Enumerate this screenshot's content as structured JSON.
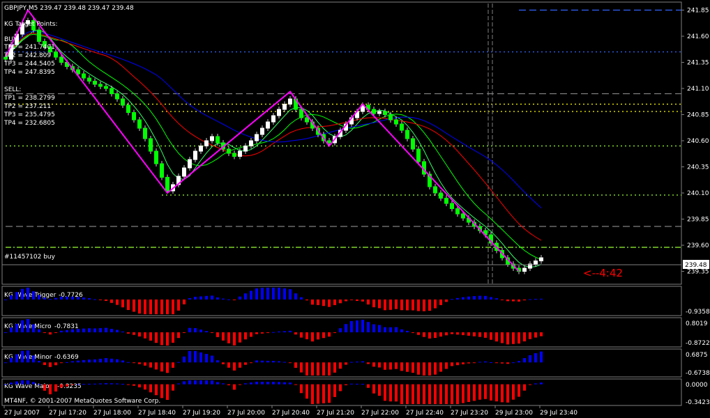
{
  "header": {
    "symbol_line": "GBPJPY,M5  239.47 239.48 239.47 239.48"
  },
  "target_points": {
    "title": "KG Target Points:",
    "buy_label": "BUY:",
    "buy": [
      "TP1 = 241.7401",
      "TP2 = 242.809",
      "TP3 = 244.5405",
      "TP4 = 247.8395"
    ],
    "sell_label": "SELL:",
    "sell": [
      "TP1 = 238.2799",
      "TP2 = 237.211",
      "TP3 = 235.4795",
      "TP4 = 232.6805"
    ]
  },
  "order_label": "#11457102 buy",
  "countdown": "<--4:42",
  "copyright": "MT4NF, © 2001-2007 MetaQuotes Software Corp.",
  "colors": {
    "bull": "#ffffff",
    "bear": "#00ff00",
    "zigzag": "#ff00ff",
    "ma_blue": "#0000ff",
    "ma_red": "#ff0000",
    "ma_green": "#00ff00",
    "ma_lime": "#33ff66",
    "hist_red": "#ff0000",
    "hist_blue": "#0000ff",
    "grid": "#808080",
    "level_yellow": "#ffff00",
    "level_blue": "#3366ff",
    "level_green": "#99ff33"
  },
  "chart_data": {
    "type": "candlestick",
    "y_ticks": [
      "241.85",
      "241.60",
      "241.35",
      "241.10",
      "240.85",
      "240.60",
      "240.35",
      "240.10",
      "239.85",
      "239.60",
      "239.35"
    ],
    "ylim": [
      239.28,
      241.88
    ],
    "current_price": "239.48",
    "x_ticks": [
      "27 Jul 2007",
      "27 Jul 17:20",
      "27 Jul 18:00",
      "27 Jul 18:40",
      "27 Jul 19:20",
      "27 Jul 20:00",
      "27 Jul 20:40",
      "27 Jul 21:20",
      "27 Jul 22:00",
      "27 Jul 22:40",
      "27 Jul 23:20",
      "29 Jul 23:00",
      "29 Jul 23:40"
    ],
    "close": [
      241.38,
      241.52,
      241.62,
      241.72,
      241.75,
      241.66,
      241.55,
      241.5,
      241.45,
      241.4,
      241.35,
      241.31,
      241.28,
      241.24,
      241.2,
      241.17,
      241.14,
      241.12,
      241.1,
      241.05,
      241.0,
      240.94,
      240.87,
      240.8,
      240.72,
      240.62,
      240.5,
      240.38,
      240.25,
      240.12,
      240.18,
      240.26,
      240.34,
      240.42,
      240.5,
      240.55,
      240.6,
      240.64,
      240.58,
      240.52,
      240.48,
      240.45,
      240.5,
      240.55,
      240.6,
      240.66,
      240.72,
      240.78,
      240.84,
      240.9,
      240.95,
      241.0,
      240.9,
      240.82,
      240.78,
      240.72,
      240.66,
      240.6,
      240.58,
      240.64,
      240.7,
      240.76,
      240.82,
      240.88,
      240.94,
      240.9,
      240.86,
      240.88,
      240.85,
      240.8,
      240.76,
      240.7,
      240.62,
      240.52,
      240.4,
      240.28,
      240.16,
      240.1,
      240.05,
      240.0,
      239.95,
      239.9,
      239.86,
      239.82,
      239.78,
      239.74,
      239.7,
      239.62,
      239.55,
      239.48,
      239.42,
      239.38,
      239.35,
      239.38,
      239.42,
      239.45,
      239.48
    ],
    "zigzag": [
      [
        0,
        241.4
      ],
      [
        4,
        241.85
      ],
      [
        29,
        240.1
      ],
      [
        51,
        241.07
      ],
      [
        58,
        240.55
      ],
      [
        64,
        240.95
      ],
      [
        92,
        239.35
      ]
    ],
    "levels": [
      {
        "price": 241.85,
        "color": "level_blue",
        "style": "dashed",
        "x0": 92
      },
      {
        "price": 241.45,
        "color": "level_blue",
        "style": "dotted",
        "x0": 0
      },
      {
        "price": 241.05,
        "color": "grid",
        "style": "dashed",
        "x0": 0
      },
      {
        "price": 240.95,
        "color": "level_yellow",
        "style": "dotted",
        "x0": 0
      },
      {
        "price": 240.88,
        "color": "level_yellow",
        "style": "dotted",
        "x0": 28
      },
      {
        "price": 240.55,
        "color": "level_green",
        "style": "dotted",
        "x0": 0
      },
      {
        "price": 240.08,
        "color": "level_green",
        "style": "dotted",
        "x0": 28
      },
      {
        "price": 239.78,
        "color": "grid",
        "style": "dashed",
        "x0": 0
      },
      {
        "price": 239.58,
        "color": "level_green",
        "style": "dashdot",
        "x0": 0
      }
    ],
    "subwindows": [
      {
        "label": "KG Wave Trigger",
        "value": "-0.7726",
        "ticks": [
          "",
          "-0.9358"
        ]
      },
      {
        "label": "KG Wave Micro",
        "value": "-0.7831",
        "ticks": [
          "0.8019",
          "-0.8722"
        ]
      },
      {
        "label": "KG Wave Minor",
        "value": "-0.6369",
        "ticks": [
          "0.6875",
          "-0.6738"
        ]
      },
      {
        "label": "KG Wave Major",
        "value": "-0.3235",
        "ticks": [
          "0.0000",
          "-0.3423"
        ]
      }
    ]
  }
}
